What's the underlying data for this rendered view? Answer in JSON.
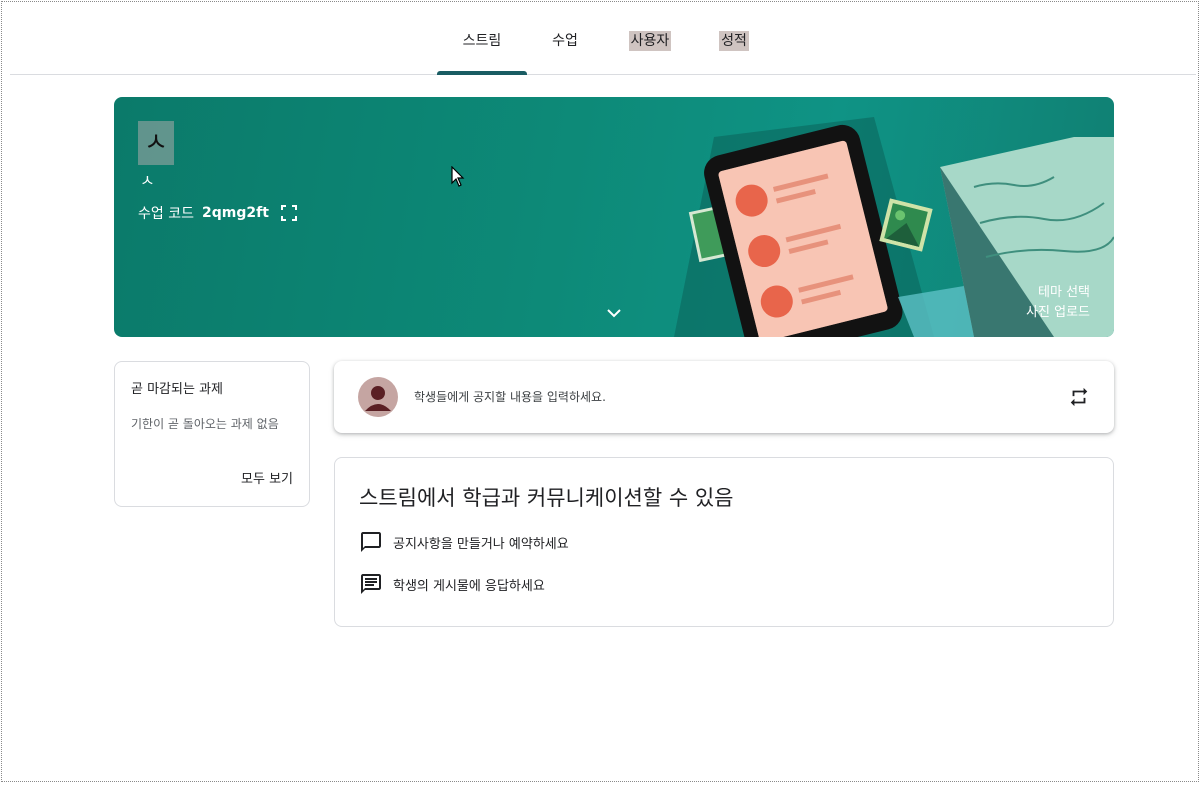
{
  "nav": {
    "tabs": [
      {
        "label": "스트림",
        "active": true
      },
      {
        "label": "수업",
        "active": false
      },
      {
        "label": "사용자",
        "active": false
      },
      {
        "label": "성적",
        "active": false
      }
    ]
  },
  "banner": {
    "class_title": "ㅅ",
    "class_subtitle": "ㅅ",
    "class_code_label": "수업 코드",
    "class_code": "2qmg2ft",
    "select_theme": "테마 선택",
    "upload_photo": "사진 업로드"
  },
  "due_work": {
    "title": "곧 마감되는 과제",
    "empty_message": "기한이 곧 돌아오는 과제 없음",
    "view_all": "모두 보기"
  },
  "announce": {
    "placeholder": "학생들에게 공지할 내용을 입력하세요."
  },
  "info": {
    "heading": "스트림에서 학급과 커뮤니케이션할 수 있음",
    "items": [
      {
        "icon": "comment-icon",
        "text": "공지사항을 만들거나 예약하세요"
      },
      {
        "icon": "reply-list-icon",
        "text": "학생의 게시물에 응답하세요"
      }
    ]
  },
  "colors": {
    "banner": "#0d8a78",
    "active_tab_indicator": "#195c63",
    "highlight": "#cfc4c1"
  }
}
